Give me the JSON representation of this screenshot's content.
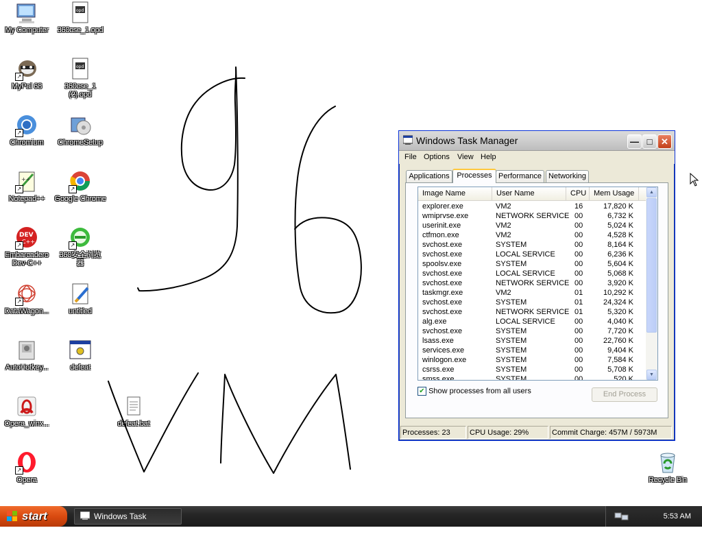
{
  "desktop": {
    "icons": [
      {
        "label": "My Computer",
        "icon": "my-computer-icon"
      },
      {
        "label": "360cse_1.opd",
        "icon": "document-icon"
      },
      {
        "label": "MyPal 68",
        "icon": "mypal-icon"
      },
      {
        "label": "360cse_1\n(2).opd",
        "icon": "document-icon"
      },
      {
        "label": "Chromium",
        "icon": "chromium-icon"
      },
      {
        "label": "ChromeSetup",
        "icon": "setup-icon"
      },
      {
        "label": "Notepad++",
        "icon": "notepad-plus-plus-icon"
      },
      {
        "label": "Google Chrome",
        "icon": "chrome-icon"
      },
      {
        "label": "Embarcadero\nDev-C++",
        "icon": "devcpp-icon"
      },
      {
        "label": "360安全浏览\n器",
        "icon": "360-browser-icon"
      },
      {
        "label": "DataWagon...",
        "icon": "datawagon-icon"
      },
      {
        "label": "untitled",
        "icon": "paint-icon"
      },
      {
        "label": "AutoHotkey...",
        "icon": "autohotkey-icon"
      },
      {
        "label": "defeat",
        "icon": "batch-window-icon"
      },
      {
        "label": "defeat.bat",
        "icon": "text-file-icon"
      },
      {
        "label": "Opera_winx...",
        "icon": "opera-installer-icon"
      },
      {
        "label": "Opera",
        "icon": "opera-icon"
      },
      {
        "label": "Recycle Bin",
        "icon": "recycle-bin-icon"
      }
    ]
  },
  "taskmgr": {
    "title": "Windows Task Manager",
    "menu": [
      "File",
      "Options",
      "View",
      "Help"
    ],
    "tabs": [
      "Applications",
      "Processes",
      "Performance",
      "Networking"
    ],
    "active_tab": "Processes",
    "columns": [
      "Image Name",
      "User Name",
      "CPU",
      "Mem Usage"
    ],
    "processes": [
      {
        "name": "explorer.exe",
        "user": "VM2",
        "cpu": "16",
        "mem": "17,820 K"
      },
      {
        "name": "wmiprvse.exe",
        "user": "NETWORK SERVICE",
        "cpu": "00",
        "mem": "6,732 K"
      },
      {
        "name": "userinit.exe",
        "user": "VM2",
        "cpu": "00",
        "mem": "5,024 K"
      },
      {
        "name": "ctfmon.exe",
        "user": "VM2",
        "cpu": "00",
        "mem": "4,528 K"
      },
      {
        "name": "svchost.exe",
        "user": "SYSTEM",
        "cpu": "00",
        "mem": "8,164 K"
      },
      {
        "name": "svchost.exe",
        "user": "LOCAL SERVICE",
        "cpu": "00",
        "mem": "6,236 K"
      },
      {
        "name": "spoolsv.exe",
        "user": "SYSTEM",
        "cpu": "00",
        "mem": "5,604 K"
      },
      {
        "name": "svchost.exe",
        "user": "LOCAL SERVICE",
        "cpu": "00",
        "mem": "5,068 K"
      },
      {
        "name": "svchost.exe",
        "user": "NETWORK SERVICE",
        "cpu": "00",
        "mem": "3,920 K"
      },
      {
        "name": "taskmgr.exe",
        "user": "VM2",
        "cpu": "01",
        "mem": "10,292 K"
      },
      {
        "name": "svchost.exe",
        "user": "SYSTEM",
        "cpu": "01",
        "mem": "24,324 K"
      },
      {
        "name": "svchost.exe",
        "user": "NETWORK SERVICE",
        "cpu": "01",
        "mem": "5,320 K"
      },
      {
        "name": "alg.exe",
        "user": "LOCAL SERVICE",
        "cpu": "00",
        "mem": "4,040 K"
      },
      {
        "name": "svchost.exe",
        "user": "SYSTEM",
        "cpu": "00",
        "mem": "7,720 K"
      },
      {
        "name": "lsass.exe",
        "user": "SYSTEM",
        "cpu": "00",
        "mem": "22,760 K"
      },
      {
        "name": "services.exe",
        "user": "SYSTEM",
        "cpu": "00",
        "mem": "9,404 K"
      },
      {
        "name": "winlogon.exe",
        "user": "SYSTEM",
        "cpu": "00",
        "mem": "7,584 K"
      },
      {
        "name": "csrss.exe",
        "user": "SYSTEM",
        "cpu": "00",
        "mem": "5,708 K"
      },
      {
        "name": "smss.exe",
        "user": "SYSTEM",
        "cpu": "00",
        "mem": "520 K"
      }
    ],
    "show_all_label": "Show processes from all users",
    "show_all_checked": true,
    "end_process_label": "End Process",
    "status": {
      "processes": "Processes: 23",
      "cpu": "CPU Usage: 29%",
      "commit": "Commit Charge: 457M / 5973M"
    }
  },
  "taskbar": {
    "start_label": "start",
    "task_label": "Windows Task Manager",
    "clock": "5:53 AM"
  },
  "colors": {
    "start_orange": "#d94a10",
    "taskbar_dark": "#262626",
    "tab_highlight": "#ffc83c"
  }
}
